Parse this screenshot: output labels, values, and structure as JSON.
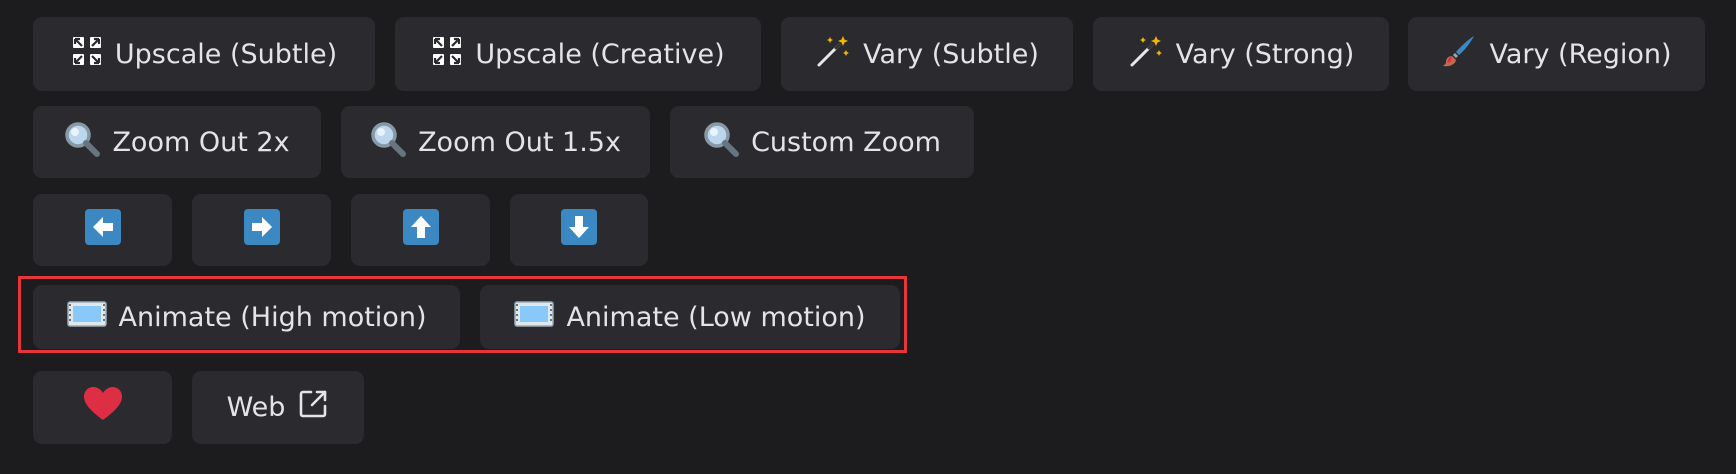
{
  "buttons": {
    "upscale_subtle": {
      "label": "Upscale (Subtle)",
      "icon": "upscale-arrows-icon"
    },
    "upscale_creative": {
      "label": "Upscale (Creative)",
      "icon": "upscale-arrows-icon"
    },
    "vary_subtle": {
      "label": "Vary (Subtle)",
      "icon": "magic-wand-icon"
    },
    "vary_strong": {
      "label": "Vary (Strong)",
      "icon": "magic-wand-icon"
    },
    "vary_region": {
      "label": "Vary (Region)",
      "icon": "paintbrush-icon"
    },
    "zoom_out_2x": {
      "label": "Zoom Out 2x",
      "icon": "magnifier-icon"
    },
    "zoom_out_1_5x": {
      "label": "Zoom Out 1.5x",
      "icon": "magnifier-icon"
    },
    "custom_zoom": {
      "label": "Custom Zoom",
      "icon": "magnifier-icon"
    },
    "pan_left": {
      "icon": "arrow-left-icon"
    },
    "pan_right": {
      "icon": "arrow-right-icon"
    },
    "pan_up": {
      "icon": "arrow-up-icon"
    },
    "pan_down": {
      "icon": "arrow-down-icon"
    },
    "animate_high": {
      "label": "Animate (High motion)",
      "icon": "film-frames-icon"
    },
    "animate_low": {
      "label": "Animate (Low motion)",
      "icon": "film-frames-icon"
    },
    "favorite": {
      "icon": "heart-icon"
    },
    "web": {
      "label": "Web",
      "icon": "external-link-icon"
    }
  },
  "colors": {
    "background": "#1c1c1f",
    "button": "#2b2b2f",
    "highlight": "#e5343a",
    "arrow_blue": "#3b88c3",
    "heart": "#dd2e44"
  }
}
